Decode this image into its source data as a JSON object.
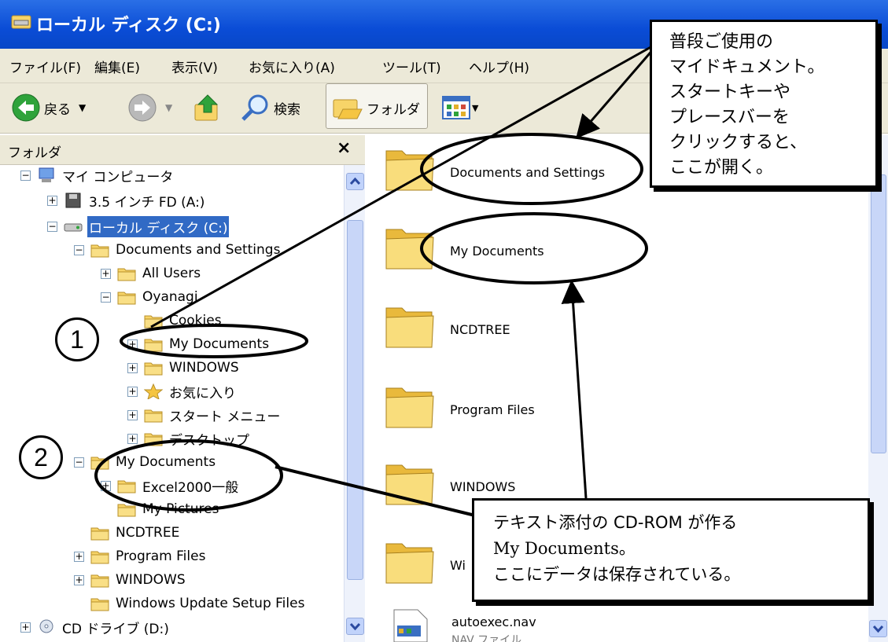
{
  "window": {
    "title": "ローカル ディスク (C:)",
    "menu": [
      "ファイル(F)",
      "編集(E)",
      "表示(V)",
      "お気に入り(A)",
      "ツール(T)",
      "ヘルプ(H)"
    ],
    "toolbar": {
      "back": "戻る",
      "search": "検索",
      "folders": "フォルダ"
    }
  },
  "folder_pane": {
    "title": "フォルダ",
    "close": "×",
    "items": [
      {
        "label": "マイ コンピュータ",
        "pm": "−",
        "icon": "computer-icon"
      },
      {
        "label": "3.5 インチ FD (A:)",
        "pm": "+",
        "icon": "floppy-icon"
      },
      {
        "label": "ローカル ディスク (C:)",
        "pm": "−",
        "icon": "drive-icon",
        "selected": true
      },
      {
        "label": "Documents and Settings",
        "pm": "−",
        "icon": "folder-icon"
      },
      {
        "label": "All Users",
        "pm": "+",
        "icon": "folder-icon"
      },
      {
        "label": "Oyanagi",
        "pm": "−",
        "icon": "folder-icon"
      },
      {
        "label": "Cookies",
        "pm": "",
        "icon": "folder-icon"
      },
      {
        "label": "My Documents",
        "pm": "+",
        "icon": "folder-icon"
      },
      {
        "label": "WINDOWS",
        "pm": "+",
        "icon": "folder-icon"
      },
      {
        "label": "お気に入り",
        "pm": "+",
        "icon": "star-icon"
      },
      {
        "label": "スタート メニュー",
        "pm": "+",
        "icon": "folder-icon"
      },
      {
        "label": "デスクトップ",
        "pm": "+",
        "icon": "folder-icon"
      },
      {
        "label": "My Documents",
        "pm": "−",
        "icon": "folder-icon"
      },
      {
        "label": "Excel2000一般",
        "pm": "+",
        "icon": "folder-icon"
      },
      {
        "label": "My Pictures",
        "pm": "",
        "icon": "folder-icon"
      },
      {
        "label": "NCDTREE",
        "pm": "",
        "icon": "folder-icon"
      },
      {
        "label": "Program Files",
        "pm": "+",
        "icon": "folder-icon"
      },
      {
        "label": "WINDOWS",
        "pm": "+",
        "icon": "folder-icon"
      },
      {
        "label": "Windows Update Setup Files",
        "pm": "",
        "icon": "folder-icon"
      },
      {
        "label": "CD ドライブ (D:)",
        "pm": "+",
        "icon": "cd-drive-icon"
      }
    ]
  },
  "content": {
    "folders": [
      "Documents and Settings",
      "My Documents",
      "NCDTREE",
      "Program Files",
      "WINDOWS",
      "Wi"
    ],
    "file": {
      "name": "autoexec.nav",
      "type": "NAV ファイル"
    }
  },
  "annotations": {
    "callout_top": [
      "普段ご使用の",
      "マイドキュメント。",
      "スタートキーや",
      "プレースバーを",
      "クリックすると、",
      "ここが開く。"
    ],
    "callout_bottom": [
      "テキスト添付の CD-ROM が作る",
      "My Documents。",
      "ここにデータは保存されている。"
    ],
    "number1": "1",
    "number2": "2"
  },
  "colors": {
    "title_bar": "#0a4cd6",
    "selection": "#316ac5",
    "folder_yellow": "#f7d468"
  }
}
